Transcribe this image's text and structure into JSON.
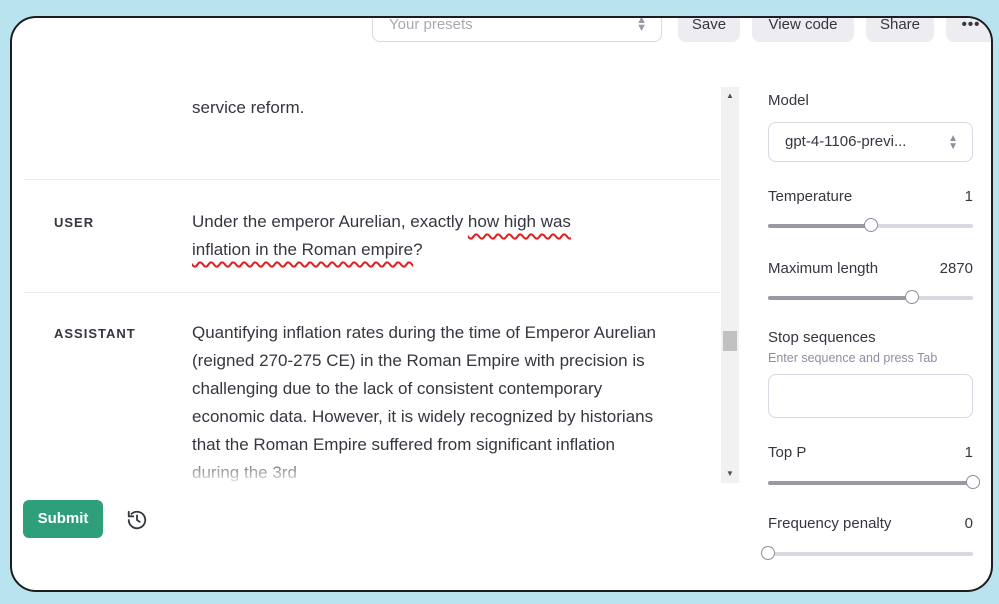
{
  "toolbar": {
    "presets_placeholder": "Your presets",
    "save_label": "Save",
    "view_code_label": "View code",
    "share_label": "Share",
    "more_label": "•••"
  },
  "messages": [
    {
      "role": "",
      "text": "service reform."
    },
    {
      "role": "USER",
      "text_plain": "Under the emperor Aurelian, exactly ",
      "text_squiggle1": "how high was",
      "text_squiggle2": "inflation in the Roman empire",
      "text_end": "?"
    },
    {
      "role": "ASSISTANT",
      "text": "Quantifying inflation rates during the time of Emperor Aurelian (reigned 270-275 CE) in the Roman Empire with precision is challenging due to the lack of consistent contemporary economic data. However, it is widely recognized by historians that the Roman Empire suffered from significant inflation during the 3rd"
    }
  ],
  "actions": {
    "submit_label": "Submit"
  },
  "settings": {
    "model_label": "Model",
    "model_value": "gpt-4-1106-previ...",
    "temperature_label": "Temperature",
    "temperature_value": "1",
    "temperature_fraction": 0.5,
    "max_length_label": "Maximum length",
    "max_length_value": "2870",
    "max_length_fraction": 0.7,
    "stop_label": "Stop sequences",
    "stop_hint": "Enter sequence and press Tab",
    "top_p_label": "Top P",
    "top_p_value": "1",
    "top_p_fraction": 1.0,
    "freq_label": "Frequency penalty",
    "freq_value": "0",
    "freq_fraction": 0.0
  },
  "colors": {
    "submit_bg": "#2f9e7a",
    "squiggle": "#e01f1f"
  }
}
